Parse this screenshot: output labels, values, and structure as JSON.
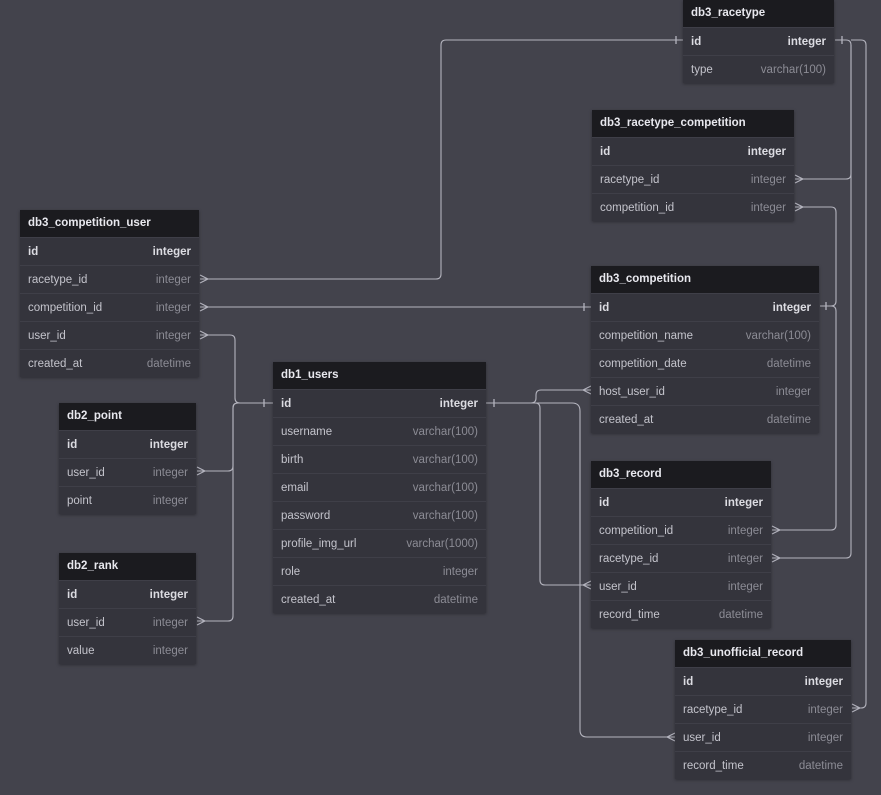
{
  "tables": {
    "db3_racetype": {
      "name": "db3_racetype",
      "fields": [
        {
          "name": "id",
          "type": "integer"
        },
        {
          "name": "type",
          "type": "varchar(100)"
        }
      ]
    },
    "db3_racetype_competition": {
      "name": "db3_racetype_competition",
      "fields": [
        {
          "name": "id",
          "type": "integer"
        },
        {
          "name": "racetype_id",
          "type": "integer"
        },
        {
          "name": "competition_id",
          "type": "integer"
        }
      ]
    },
    "db3_competition_user": {
      "name": "db3_competition_user",
      "fields": [
        {
          "name": "id",
          "type": "integer"
        },
        {
          "name": "racetype_id",
          "type": "integer"
        },
        {
          "name": "competition_id",
          "type": "integer"
        },
        {
          "name": "user_id",
          "type": "integer"
        },
        {
          "name": "created_at",
          "type": "datetime"
        }
      ]
    },
    "db3_competition": {
      "name": "db3_competition",
      "fields": [
        {
          "name": "id",
          "type": "integer"
        },
        {
          "name": "competition_name",
          "type": "varchar(100)"
        },
        {
          "name": "competition_date",
          "type": "datetime"
        },
        {
          "name": "host_user_id",
          "type": "integer"
        },
        {
          "name": "created_at",
          "type": "datetime"
        }
      ]
    },
    "db1_users": {
      "name": "db1_users",
      "fields": [
        {
          "name": "id",
          "type": "integer"
        },
        {
          "name": "username",
          "type": "varchar(100)"
        },
        {
          "name": "birth",
          "type": "varchar(100)"
        },
        {
          "name": "email",
          "type": "varchar(100)"
        },
        {
          "name": "password",
          "type": "varchar(100)"
        },
        {
          "name": "profile_img_url",
          "type": "varchar(1000)"
        },
        {
          "name": "role",
          "type": "integer"
        },
        {
          "name": "created_at",
          "type": "datetime"
        }
      ]
    },
    "db2_point": {
      "name": "db2_point",
      "fields": [
        {
          "name": "id",
          "type": "integer"
        },
        {
          "name": "user_id",
          "type": "integer"
        },
        {
          "name": "point",
          "type": "integer"
        }
      ]
    },
    "db2_rank": {
      "name": "db2_rank",
      "fields": [
        {
          "name": "id",
          "type": "integer"
        },
        {
          "name": "user_id",
          "type": "integer"
        },
        {
          "name": "value",
          "type": "integer"
        }
      ]
    },
    "db3_record": {
      "name": "db3_record",
      "fields": [
        {
          "name": "id",
          "type": "integer"
        },
        {
          "name": "competition_id",
          "type": "integer"
        },
        {
          "name": "racetype_id",
          "type": "integer"
        },
        {
          "name": "user_id",
          "type": "integer"
        },
        {
          "name": "record_time",
          "type": "datetime"
        }
      ]
    },
    "db3_unofficial_record": {
      "name": "db3_unofficial_record",
      "fields": [
        {
          "name": "id",
          "type": "integer"
        },
        {
          "name": "racetype_id",
          "type": "integer"
        },
        {
          "name": "user_id",
          "type": "integer"
        },
        {
          "name": "record_time",
          "type": "datetime"
        }
      ]
    }
  },
  "relations": [
    {
      "from": "db3_competition_user.racetype_id",
      "to": "db3_racetype.id"
    },
    {
      "from": "db3_racetype_competition.racetype_id",
      "to": "db3_racetype.id"
    },
    {
      "from": "db3_record.racetype_id",
      "to": "db3_racetype.id"
    },
    {
      "from": "db3_unofficial_record.racetype_id",
      "to": "db3_racetype.id"
    },
    {
      "from": "db3_racetype_competition.competition_id",
      "to": "db3_competition.id"
    },
    {
      "from": "db3_record.competition_id",
      "to": "db3_competition.id"
    },
    {
      "from": "db3_competition_user.competition_id",
      "to": "db3_competition.id"
    },
    {
      "from": "db3_competition_user.user_id",
      "to": "db1_users.id"
    },
    {
      "from": "db2_point.user_id",
      "to": "db1_users.id"
    },
    {
      "from": "db2_rank.user_id",
      "to": "db1_users.id"
    },
    {
      "from": "db3_competition.host_user_id",
      "to": "db1_users.id"
    },
    {
      "from": "db3_record.user_id",
      "to": "db1_users.id"
    },
    {
      "from": "db3_unofficial_record.user_id",
      "to": "db1_users.id"
    }
  ],
  "colors": {
    "canvas": "#43434c",
    "table_header": "#1b1b1f",
    "table_body": "#34343c",
    "connector": "#b4b4be"
  }
}
